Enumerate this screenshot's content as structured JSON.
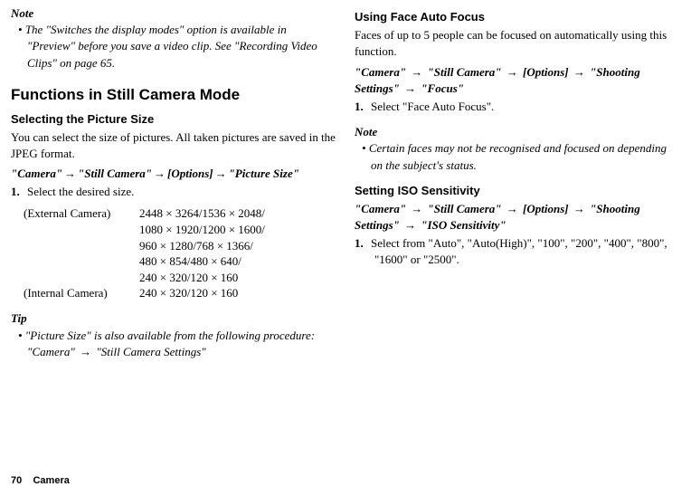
{
  "left": {
    "note_label": "Note",
    "note_body": "The \"Switches the display modes\" option is available in \"Preview\" before you save a video clip. See \"Recording Video Clips\" on page 65.",
    "section_heading": "Functions in Still Camera Mode",
    "sub1": "Selecting the Picture Size",
    "sub1_body": "You can select the size of pictures. All taken pictures are saved in the JPEG format.",
    "path1_a": "\"Camera\"",
    "path1_b": "\"Still Camera\"",
    "path1_c": "[Options]",
    "path1_d": "\"Picture Size\"",
    "step1_num": "1.",
    "step1_text": "Select the desired size.",
    "ext_label": "(External Camera)",
    "ext_l1": "2448 × 3264/1536 × 2048/",
    "ext_l2": "1080 × 1920/1200 × 1600/",
    "ext_l3": "960 × 1280/768 × 1366/",
    "ext_l4": "480 × 854/480 × 640/",
    "ext_l5": "240 × 320/120 × 160",
    "int_label": "(Internal Camera)",
    "int_l1": "240 × 320/120 × 160",
    "tip_label": "Tip",
    "tip_body": "\"Picture Size\" is also available from the following procedure:",
    "tip_path_a": "\"Camera\"",
    "tip_path_b": "\"Still Camera Settings\""
  },
  "right": {
    "sub2": "Using Face Auto Focus",
    "sub2_body": "Faces of up to 5 people can be focused on automatically using this function.",
    "path2_a": "\"Camera\"",
    "path2_b": "\"Still Camera\"",
    "path2_c": "[Options]",
    "path2_d": "\"Shooting Settings\"",
    "path2_e": "\"Focus\"",
    "step2_num": "1.",
    "step2_text": "Select \"Face Auto Focus\".",
    "note2_label": "Note",
    "note2_body": "Certain faces may not be recognised and focused on depending on the subject's status.",
    "sub3": "Setting ISO Sensitivity",
    "path3_a": "\"Camera\"",
    "path3_b": "\"Still Camera\"",
    "path3_c": "[Options]",
    "path3_d": "\"Shooting Settings\"",
    "path3_e": "\"ISO Sensitivity\"",
    "step3_num": "1.",
    "step3_text": "Select from \"Auto\", \"Auto(High)\", \"100\", \"200\", \"400\", \"800\", \"1600\" or \"2500\"."
  },
  "footer": {
    "page_num": "70",
    "section": "Camera"
  },
  "arrow": "→"
}
